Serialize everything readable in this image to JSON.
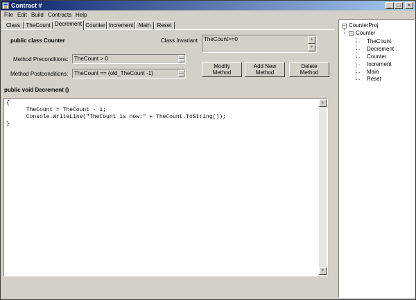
{
  "window": {
    "title": "Contract #",
    "min_glyph": "_",
    "max_glyph": "□",
    "close_glyph": "×"
  },
  "menu": [
    "File",
    "Edit",
    "Build",
    "Contracts",
    "Help"
  ],
  "tabs": [
    "Class",
    "TheCount",
    "Decrement",
    "Counter",
    "Increment",
    "Main",
    "Reset"
  ],
  "active_tab": "Decrement",
  "form": {
    "class_label": "public class Counter",
    "invariant_label": "Class Invariant",
    "invariant_value": "TheCount>=0",
    "precond_label": "Method Preconditions:",
    "precond_value": "TheCount > 0",
    "postcond_label": "Method Postconditions:",
    "postcond_value": "TheCount == (old_TheCount -1)",
    "modify_label_1": "Modify",
    "modify_label_2": "Method",
    "add_label_1": "Add New",
    "add_label_2": "Method",
    "delete_label_1": "Delete",
    "delete_label_2": "Method",
    "method_signature": "public void Decrement ()"
  },
  "code_lines": [
    "{",
    "      TheCount = TheCount - 1;",
    "      Console.WriteLine(\"TheCount is now:\" + TheCount.ToString());",
    "}"
  ],
  "tree": {
    "root": "CounterProj",
    "class_node": "Counter",
    "members": [
      "TheCount",
      "Decrement",
      "Counter",
      "Increment",
      "Main",
      "Reset"
    ],
    "collapse_glyph": "−"
  }
}
